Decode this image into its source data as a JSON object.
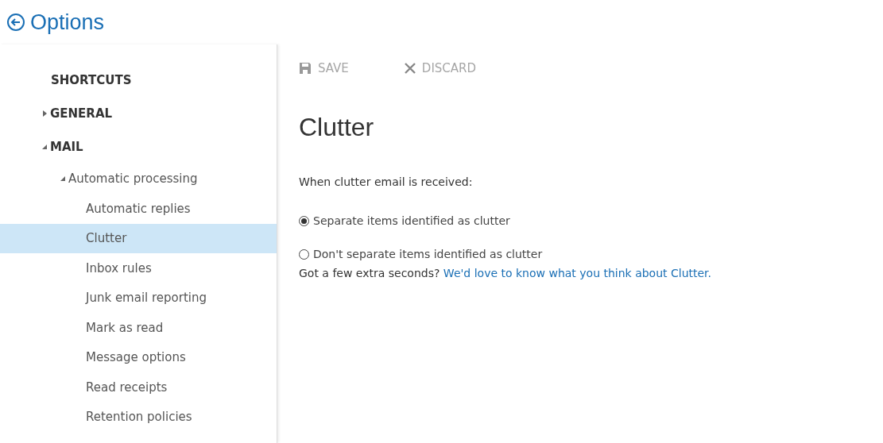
{
  "header": {
    "title": "Options"
  },
  "nav": [
    {
      "label": "SHORTCUTS"
    },
    {
      "label": "GENERAL",
      "expanded": false
    },
    {
      "label": "MAIL",
      "expanded": true,
      "children": [
        {
          "label": "Automatic processing",
          "expanded": true,
          "children": [
            {
              "label": "Automatic replies",
              "selected": false
            },
            {
              "label": "Clutter",
              "selected": true
            },
            {
              "label": "Inbox rules",
              "selected": false
            },
            {
              "label": "Junk email reporting",
              "selected": false
            },
            {
              "label": "Mark as read",
              "selected": false
            },
            {
              "label": "Message options",
              "selected": false
            },
            {
              "label": "Read receipts",
              "selected": false
            },
            {
              "label": "Retention policies",
              "selected": false
            }
          ]
        }
      ]
    }
  ],
  "toolbar": [
    {
      "kind": "save",
      "label": "SAVE",
      "disabled": true
    },
    {
      "kind": "discard",
      "label": "DISCARD",
      "disabled": true
    }
  ],
  "page": {
    "heading": "Clutter",
    "prompt": "When clutter email is received:",
    "options": [
      {
        "label": "Separate items identified as clutter",
        "selected": true
      },
      {
        "label": "Don't separate items identified as clutter",
        "selected": false
      }
    ],
    "feedback": {
      "text": "Got a few extra seconds?",
      "link": "We'd love to know what you think about Clutter."
    }
  }
}
